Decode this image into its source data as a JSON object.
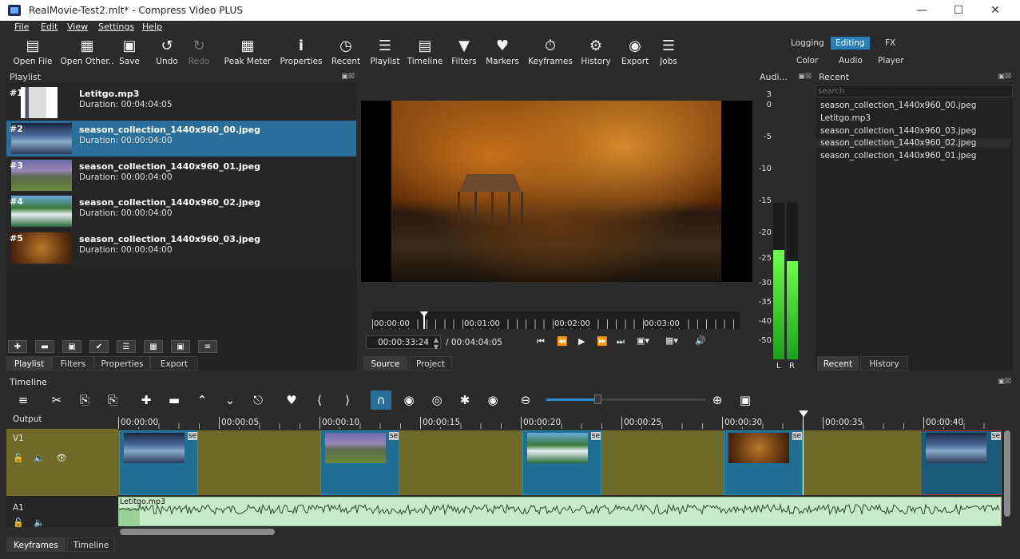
{
  "window": {
    "title": "RealMovie-Test2.mlt* - Compress Video PLUS"
  },
  "menu": [
    "File",
    "Edit",
    "View",
    "Settings",
    "Help"
  ],
  "toolbar": [
    {
      "label": "Open File",
      "icon": "folder-open-icon"
    },
    {
      "label": "Open Other..",
      "icon": "folder-plus-icon"
    },
    {
      "label": "Save",
      "icon": "save-icon"
    },
    {
      "label": "Undo",
      "icon": "undo-icon"
    },
    {
      "label": "Redo",
      "icon": "redo-icon",
      "disabled": true
    },
    {
      "label": "Peak Meter",
      "icon": "bar-chart-icon"
    },
    {
      "label": "Properties",
      "icon": "info-icon"
    },
    {
      "label": "Recent",
      "icon": "clock-icon"
    },
    {
      "label": "Playlist",
      "icon": "list-icon"
    },
    {
      "label": "Timeline",
      "icon": "timeline-icon"
    },
    {
      "label": "Filters",
      "icon": "funnel-icon"
    },
    {
      "label": "Markers",
      "icon": "marker-icon"
    },
    {
      "label": "Keyframes",
      "icon": "stopwatch-icon"
    },
    {
      "label": "History",
      "icon": "history-icon"
    },
    {
      "label": "Export",
      "icon": "disc-icon"
    },
    {
      "label": "Jobs",
      "icon": "database-icon"
    }
  ],
  "layouts": {
    "logging": "Logging",
    "editing": "Editing",
    "fx": "FX",
    "color": "Color",
    "audio": "Audio",
    "player": "Player"
  },
  "playlist": {
    "title": "Playlist",
    "items": [
      {
        "num": "#1",
        "name": "Letitgo.mp3",
        "duration": "Duration: 00:04:04:05"
      },
      {
        "num": "#2",
        "name": "season_collection_1440x960_00.jpeg",
        "duration": "Duration: 00:00:04:00"
      },
      {
        "num": "#3",
        "name": "season_collection_1440x960_01.jpeg",
        "duration": "Duration: 00:00:04:00"
      },
      {
        "num": "#4",
        "name": "season_collection_1440x960_02.jpeg",
        "duration": "Duration: 00:00:04:00"
      },
      {
        "num": "#5",
        "name": "season_collection_1440x960_03.jpeg",
        "duration": "Duration: 00:00:04:00"
      }
    ],
    "tabs": [
      "Playlist",
      "Filters",
      "Properties",
      "Export"
    ]
  },
  "player": {
    "ruler": [
      "00:00:00",
      "00:01:00",
      "00:02:00",
      "00:03:00"
    ],
    "position": "00:00:33:24",
    "duration": "/ 00:04:04:05",
    "tabs": [
      "Source",
      "Project"
    ]
  },
  "audio": {
    "title": "Audi...",
    "scale": [
      "3",
      "0",
      "-5",
      "-10",
      "-15",
      "-20",
      "-25",
      "-30",
      "-35",
      "-40",
      "-50"
    ],
    "channels": [
      "L",
      "R"
    ],
    "levels": [
      0.7,
      0.63
    ]
  },
  "recent": {
    "title": "Recent",
    "search_placeholder": "search",
    "items": [
      "season_collection_1440x960_00.jpeg",
      "Letitgo.mp3",
      "season_collection_1440x960_03.jpeg",
      "season_collection_1440x960_02.jpeg",
      "season_collection_1440x960_01.jpeg"
    ],
    "tabs": [
      "Recent",
      "History"
    ]
  },
  "timeline": {
    "title": "Timeline",
    "output": "Output",
    "ruler": [
      "00:00:00",
      "00:00:05",
      "00:00:10",
      "00:00:15",
      "00:00:20",
      "00:00:25",
      "00:00:30",
      "00:00:35",
      "00:00:40"
    ],
    "tracks": {
      "v1": "V1",
      "a1": "A1"
    },
    "clip_label": "se",
    "audio_clip": "Letitgo.mp3",
    "bottom_tabs": [
      "Keyframes",
      "Timeline"
    ]
  }
}
